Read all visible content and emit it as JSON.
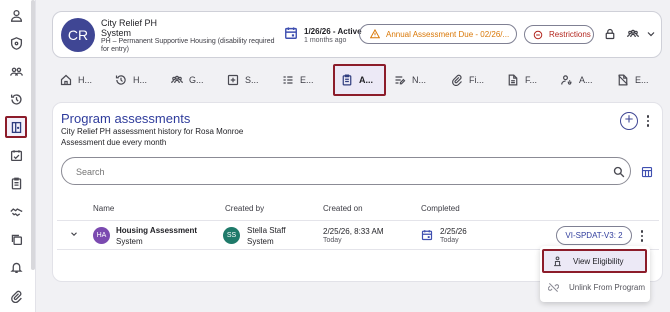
{
  "sidebar": {
    "items": [
      {
        "icon": "person-icon"
      },
      {
        "icon": "shield-icon"
      },
      {
        "icon": "people-icon"
      },
      {
        "icon": "history-icon"
      },
      {
        "icon": "program-door-icon",
        "active": true
      },
      {
        "icon": "calendar-check-icon"
      },
      {
        "icon": "clipboard-icon"
      },
      {
        "icon": "handshake-icon"
      },
      {
        "icon": "copy-icon"
      },
      {
        "icon": "bell-icon"
      },
      {
        "icon": "paperclip-icon"
      }
    ]
  },
  "header": {
    "avatar_initials": "CR",
    "client_name": "City Relief PH",
    "client_sub": "System",
    "program": "PH – Permanent Supportive Housing (disability required for entry)",
    "date_status": "1/26/26 - Active",
    "date_ago": "1 months ago",
    "due_label": "Annual Assessment Due - 02/26/...",
    "restrictions_label": "Restrictions"
  },
  "tabs": [
    {
      "label": "H...",
      "icon": "home-icon"
    },
    {
      "label": "H...",
      "icon": "history-icon"
    },
    {
      "label": "G...",
      "icon": "group-icon"
    },
    {
      "label": "S...",
      "icon": "plus-square-icon"
    },
    {
      "label": "E...",
      "icon": "list-icon"
    },
    {
      "label": "A...",
      "icon": "assessment-icon",
      "active": true
    },
    {
      "label": "N...",
      "icon": "notes-icon"
    },
    {
      "label": "Fi...",
      "icon": "attach-icon"
    },
    {
      "label": "F...",
      "icon": "file-icon"
    },
    {
      "label": "A...",
      "icon": "person-gear-icon"
    },
    {
      "label": "E...",
      "icon": "no-file-icon"
    }
  ],
  "main": {
    "title": "Program assessments",
    "subtitle": "City Relief PH assessment history for Rosa Monroe",
    "due_text": "Assessment due every month",
    "search_placeholder": "Search",
    "columns": {
      "name": "Name",
      "created_by": "Created by",
      "created_on": "Created on",
      "completed": "Completed"
    },
    "rows": [
      {
        "avatar": "HA",
        "name": "Housing Assessment",
        "name_sub": "System",
        "creator_avatar": "SS",
        "creator": "Stella Staff",
        "creator_sub": "System",
        "created_on": "2/25/26, 8:33 AM",
        "created_on_sub": "Today",
        "completed": "2/25/26",
        "completed_sub": "Today",
        "badge": "VI-SPDAT-V3: 2"
      }
    ]
  },
  "menu": {
    "items": [
      {
        "label": "View Eligibility",
        "icon": "person-stand-icon"
      },
      {
        "label": "Unlink From Program",
        "icon": "unlink-icon"
      }
    ]
  },
  "colors": {
    "accent": "#3f4694",
    "warning": "#d97706",
    "danger": "#b3261e",
    "highlight_border": "#8c1c2a"
  }
}
